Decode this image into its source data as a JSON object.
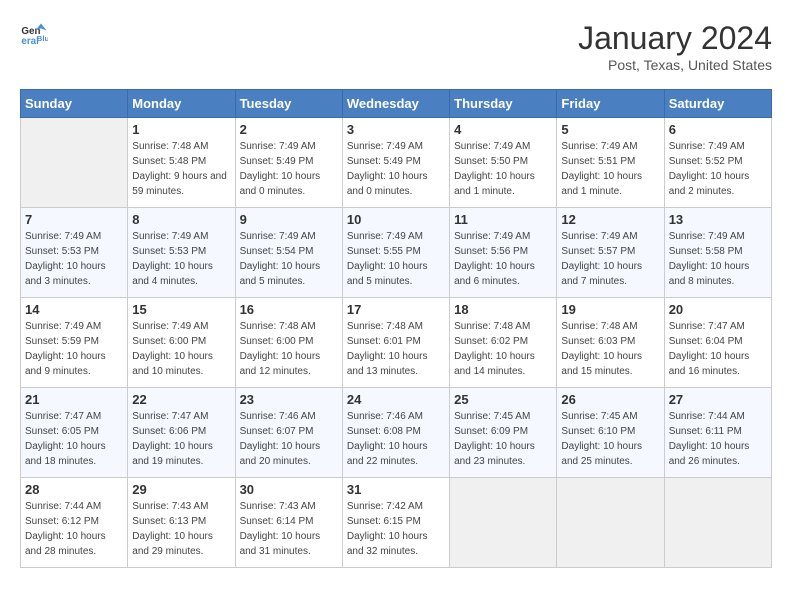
{
  "header": {
    "logo_general": "General",
    "logo_blue": "Blue",
    "month": "January 2024",
    "location": "Post, Texas, United States"
  },
  "days_of_week": [
    "Sunday",
    "Monday",
    "Tuesday",
    "Wednesday",
    "Thursday",
    "Friday",
    "Saturday"
  ],
  "weeks": [
    [
      null,
      {
        "day": 1,
        "sunrise": "7:48 AM",
        "sunset": "5:48 PM",
        "daylight": "9 hours and 59 minutes."
      },
      {
        "day": 2,
        "sunrise": "7:49 AM",
        "sunset": "5:49 PM",
        "daylight": "10 hours and 0 minutes."
      },
      {
        "day": 3,
        "sunrise": "7:49 AM",
        "sunset": "5:49 PM",
        "daylight": "10 hours and 0 minutes."
      },
      {
        "day": 4,
        "sunrise": "7:49 AM",
        "sunset": "5:50 PM",
        "daylight": "10 hours and 1 minute."
      },
      {
        "day": 5,
        "sunrise": "7:49 AM",
        "sunset": "5:51 PM",
        "daylight": "10 hours and 1 minute."
      },
      {
        "day": 6,
        "sunrise": "7:49 AM",
        "sunset": "5:52 PM",
        "daylight": "10 hours and 2 minutes."
      }
    ],
    [
      {
        "day": 7,
        "sunrise": "7:49 AM",
        "sunset": "5:53 PM",
        "daylight": "10 hours and 3 minutes."
      },
      {
        "day": 8,
        "sunrise": "7:49 AM",
        "sunset": "5:53 PM",
        "daylight": "10 hours and 4 minutes."
      },
      {
        "day": 9,
        "sunrise": "7:49 AM",
        "sunset": "5:54 PM",
        "daylight": "10 hours and 5 minutes."
      },
      {
        "day": 10,
        "sunrise": "7:49 AM",
        "sunset": "5:55 PM",
        "daylight": "10 hours and 5 minutes."
      },
      {
        "day": 11,
        "sunrise": "7:49 AM",
        "sunset": "5:56 PM",
        "daylight": "10 hours and 6 minutes."
      },
      {
        "day": 12,
        "sunrise": "7:49 AM",
        "sunset": "5:57 PM",
        "daylight": "10 hours and 7 minutes."
      },
      {
        "day": 13,
        "sunrise": "7:49 AM",
        "sunset": "5:58 PM",
        "daylight": "10 hours and 8 minutes."
      }
    ],
    [
      {
        "day": 14,
        "sunrise": "7:49 AM",
        "sunset": "5:59 PM",
        "daylight": "10 hours and 9 minutes."
      },
      {
        "day": 15,
        "sunrise": "7:49 AM",
        "sunset": "6:00 PM",
        "daylight": "10 hours and 10 minutes."
      },
      {
        "day": 16,
        "sunrise": "7:48 AM",
        "sunset": "6:00 PM",
        "daylight": "10 hours and 12 minutes."
      },
      {
        "day": 17,
        "sunrise": "7:48 AM",
        "sunset": "6:01 PM",
        "daylight": "10 hours and 13 minutes."
      },
      {
        "day": 18,
        "sunrise": "7:48 AM",
        "sunset": "6:02 PM",
        "daylight": "10 hours and 14 minutes."
      },
      {
        "day": 19,
        "sunrise": "7:48 AM",
        "sunset": "6:03 PM",
        "daylight": "10 hours and 15 minutes."
      },
      {
        "day": 20,
        "sunrise": "7:47 AM",
        "sunset": "6:04 PM",
        "daylight": "10 hours and 16 minutes."
      }
    ],
    [
      {
        "day": 21,
        "sunrise": "7:47 AM",
        "sunset": "6:05 PM",
        "daylight": "10 hours and 18 minutes."
      },
      {
        "day": 22,
        "sunrise": "7:47 AM",
        "sunset": "6:06 PM",
        "daylight": "10 hours and 19 minutes."
      },
      {
        "day": 23,
        "sunrise": "7:46 AM",
        "sunset": "6:07 PM",
        "daylight": "10 hours and 20 minutes."
      },
      {
        "day": 24,
        "sunrise": "7:46 AM",
        "sunset": "6:08 PM",
        "daylight": "10 hours and 22 minutes."
      },
      {
        "day": 25,
        "sunrise": "7:45 AM",
        "sunset": "6:09 PM",
        "daylight": "10 hours and 23 minutes."
      },
      {
        "day": 26,
        "sunrise": "7:45 AM",
        "sunset": "6:10 PM",
        "daylight": "10 hours and 25 minutes."
      },
      {
        "day": 27,
        "sunrise": "7:44 AM",
        "sunset": "6:11 PM",
        "daylight": "10 hours and 26 minutes."
      }
    ],
    [
      {
        "day": 28,
        "sunrise": "7:44 AM",
        "sunset": "6:12 PM",
        "daylight": "10 hours and 28 minutes."
      },
      {
        "day": 29,
        "sunrise": "7:43 AM",
        "sunset": "6:13 PM",
        "daylight": "10 hours and 29 minutes."
      },
      {
        "day": 30,
        "sunrise": "7:43 AM",
        "sunset": "6:14 PM",
        "daylight": "10 hours and 31 minutes."
      },
      {
        "day": 31,
        "sunrise": "7:42 AM",
        "sunset": "6:15 PM",
        "daylight": "10 hours and 32 minutes."
      },
      null,
      null,
      null
    ]
  ]
}
